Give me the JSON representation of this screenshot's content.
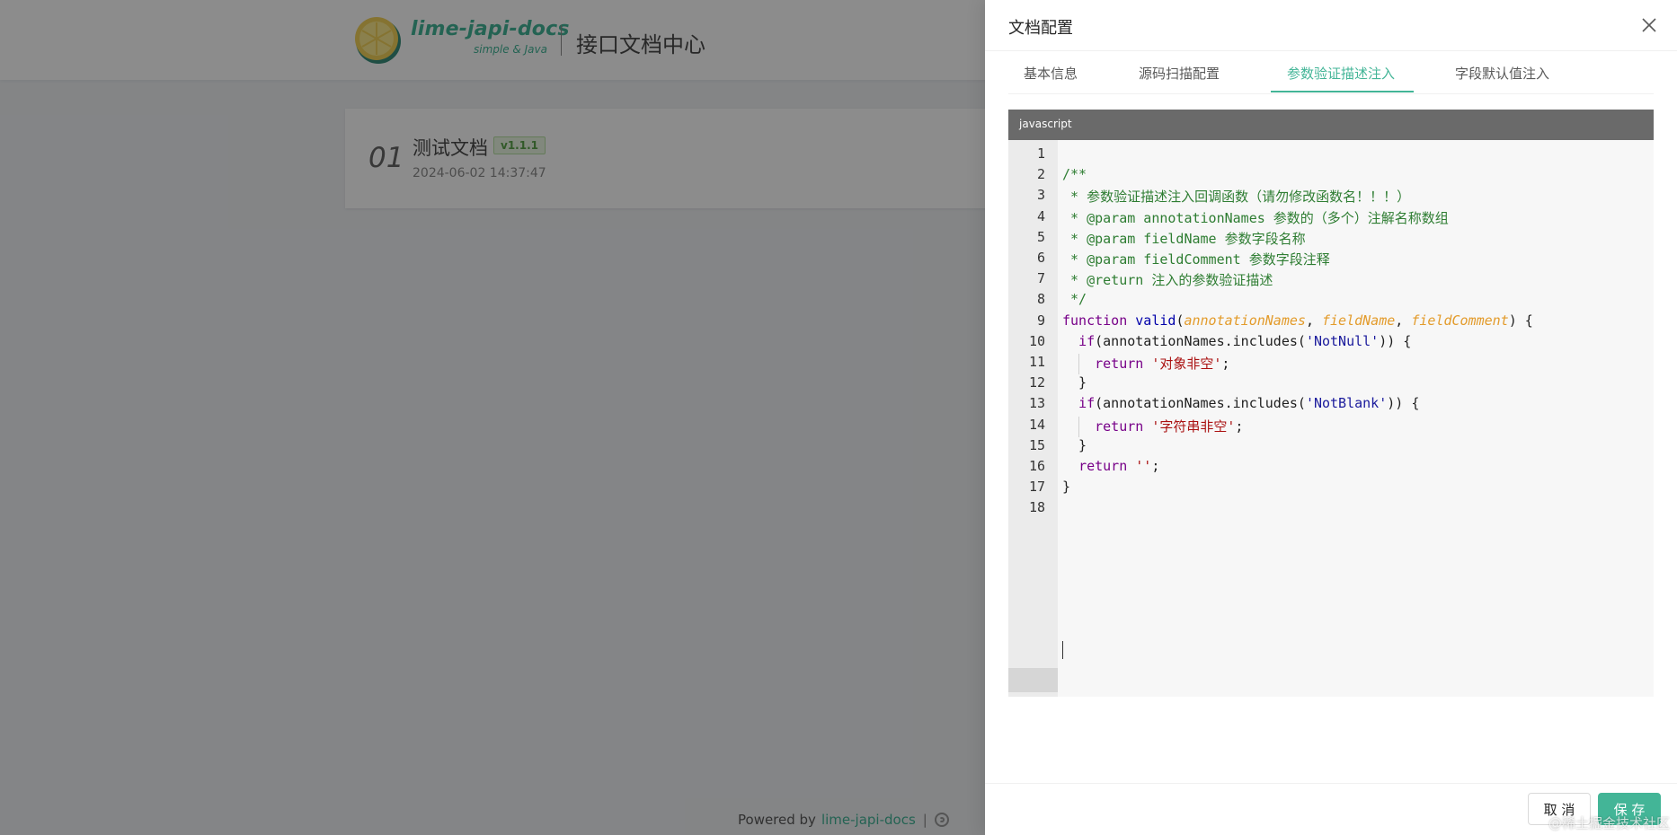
{
  "header": {
    "brand_name": "lime-japi-docs",
    "brand_sub": "simple & Java",
    "title": "接口文档中心"
  },
  "doc_card": {
    "index": "01",
    "title": "测试文档",
    "version": "v1.1.1",
    "date": "2024-06-02 14:37:47"
  },
  "footer": {
    "powered_by": "Powered by",
    "link": "lime-japi-docs",
    "separator": "|",
    "icon": "github-icon"
  },
  "drawer": {
    "title": "文档配置",
    "tabs": [
      {
        "label": "基本信息",
        "active": false
      },
      {
        "label": "源码扫描配置",
        "active": false
      },
      {
        "label": "参数验证描述注入",
        "active": true
      },
      {
        "label": "字段默认值注入",
        "active": false
      }
    ],
    "editor": {
      "language": "javascript",
      "line_numbers": [
        "1",
        "2",
        "3",
        "4",
        "5",
        "6",
        "7",
        "8",
        "9",
        "10",
        "11",
        "12",
        "13",
        "14",
        "15",
        "16",
        "17",
        "18"
      ],
      "active_line": 18,
      "lines": [
        [],
        [
          {
            "t": "/**",
            "c": "cm"
          }
        ],
        [
          {
            "t": " * 参数验证描述注入回调函数（请勿修改函数名！！！）",
            "c": "cm"
          }
        ],
        [
          {
            "t": " * @param annotationNames 参数的（多个）注解名称数组",
            "c": "cm"
          }
        ],
        [
          {
            "t": " * @param fieldName 参数字段名称",
            "c": "cm"
          }
        ],
        [
          {
            "t": " * @param fieldComment 参数字段注释",
            "c": "cm"
          }
        ],
        [
          {
            "t": " * @return 注入的参数验证描述",
            "c": "cm"
          }
        ],
        [
          {
            "t": " */",
            "c": "cm"
          }
        ],
        [
          {
            "t": "function",
            "c": "kw"
          },
          {
            "t": " ",
            "c": "pl"
          },
          {
            "t": "valid",
            "c": "fn"
          },
          {
            "t": "(",
            "c": "pl"
          },
          {
            "t": "annotationNames",
            "c": "pm"
          },
          {
            "t": ", ",
            "c": "pl"
          },
          {
            "t": "fieldName",
            "c": "pm"
          },
          {
            "t": ", ",
            "c": "pl"
          },
          {
            "t": "fieldComment",
            "c": "pm"
          },
          {
            "t": ") {",
            "c": "pl"
          }
        ],
        [
          {
            "t": "  ",
            "c": "pl"
          },
          {
            "t": "if",
            "c": "kw"
          },
          {
            "t": "(annotationNames.includes(",
            "c": "pl"
          },
          {
            "t": "'NotNull'",
            "c": "str"
          },
          {
            "t": ")) {",
            "c": "pl"
          }
        ],
        [
          {
            "t": "    ",
            "c": "pl"
          },
          {
            "t": "return",
            "c": "kw"
          },
          {
            "t": " ",
            "c": "pl"
          },
          {
            "t": "'对象非空'",
            "c": "st"
          },
          {
            "t": ";",
            "c": "pl"
          }
        ],
        [
          {
            "t": "  }",
            "c": "pl"
          }
        ],
        [
          {
            "t": "  ",
            "c": "pl"
          },
          {
            "t": "if",
            "c": "kw"
          },
          {
            "t": "(annotationNames.includes(",
            "c": "pl"
          },
          {
            "t": "'NotBlank'",
            "c": "str"
          },
          {
            "t": ")) {",
            "c": "pl"
          }
        ],
        [
          {
            "t": "    ",
            "c": "pl"
          },
          {
            "t": "return",
            "c": "kw"
          },
          {
            "t": " ",
            "c": "pl"
          },
          {
            "t": "'字符串非空'",
            "c": "st"
          },
          {
            "t": ";",
            "c": "pl"
          }
        ],
        [
          {
            "t": "  }",
            "c": "pl"
          }
        ],
        [
          {
            "t": "  ",
            "c": "pl"
          },
          {
            "t": "return",
            "c": "kw"
          },
          {
            "t": " ",
            "c": "pl"
          },
          {
            "t": "''",
            "c": "st"
          },
          {
            "t": ";",
            "c": "pl"
          }
        ],
        [
          {
            "t": "}",
            "c": "pl"
          }
        ],
        []
      ]
    },
    "buttons": {
      "cancel": "取 消",
      "save": "保 存"
    }
  },
  "watermark": "@稀土掘金技术社区",
  "colors": {
    "accent": "#43b597",
    "editor_bar": "#6a6a6a",
    "comment": "#2e7d32",
    "keyword": "#770088",
    "param": "#e39b2b"
  }
}
